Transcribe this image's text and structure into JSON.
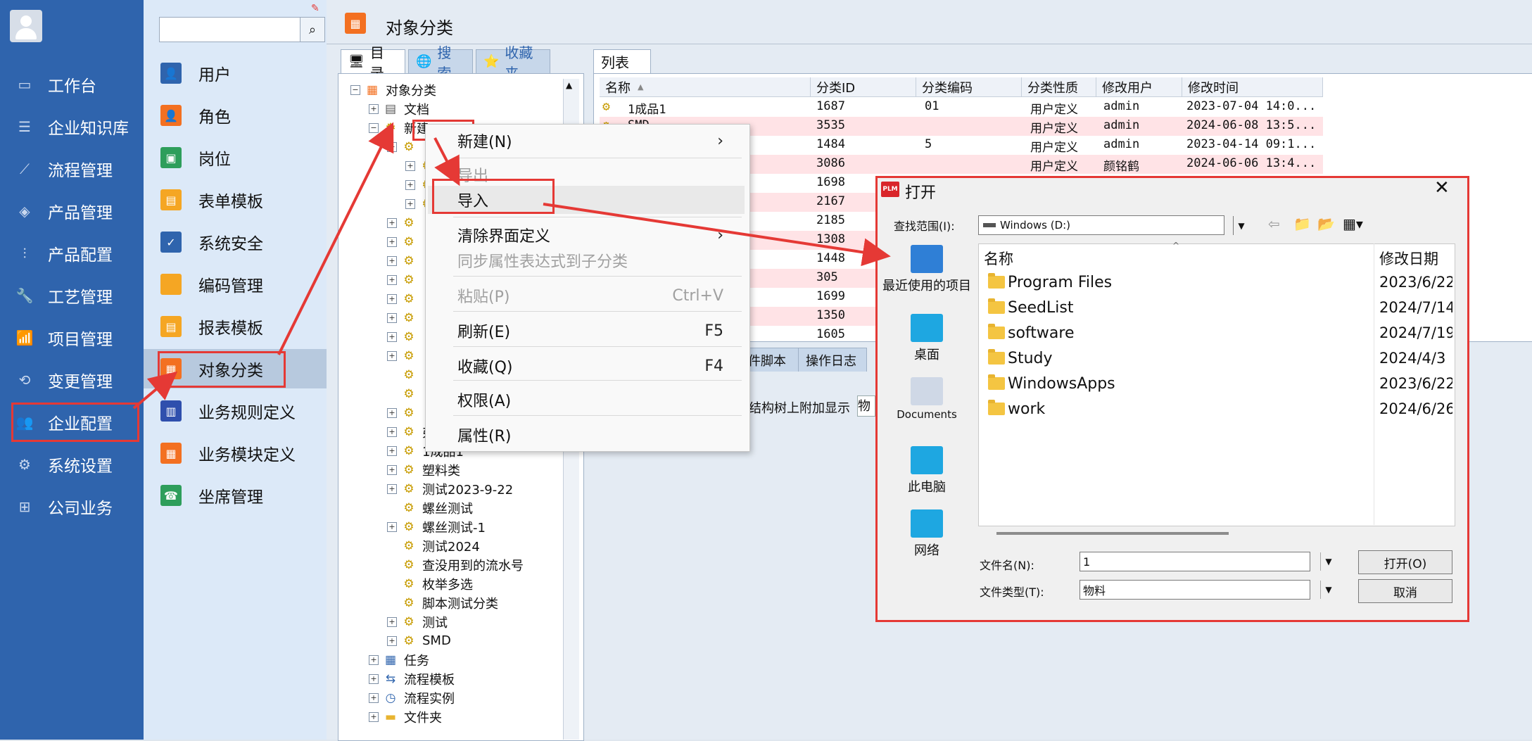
{
  "leftnav": {
    "items": [
      {
        "label": "工作台",
        "icon": "monitor-icon"
      },
      {
        "label": "企业知识库",
        "icon": "book-icon"
      },
      {
        "label": "流程管理",
        "icon": "flow-icon"
      },
      {
        "label": "产品管理",
        "icon": "cube-icon"
      },
      {
        "label": "产品配置",
        "icon": "sliders-icon"
      },
      {
        "label": "工艺管理",
        "icon": "wrench-icon"
      },
      {
        "label": "项目管理",
        "icon": "chart-icon"
      },
      {
        "label": "变更管理",
        "icon": "change-icon"
      },
      {
        "label": "企业配置",
        "icon": "users-icon"
      },
      {
        "label": "系统设置",
        "icon": "gear-icon"
      },
      {
        "label": "公司业务",
        "icon": "grid-icon"
      }
    ]
  },
  "subnav": {
    "items": [
      {
        "label": "用户",
        "color": "#2f64ad"
      },
      {
        "label": "角色",
        "color": "#f37021"
      },
      {
        "label": "岗位",
        "color": "#2e9e5b"
      },
      {
        "label": "表单模板",
        "color": "#f5a623"
      },
      {
        "label": "系统安全",
        "color": "#2f64ad"
      },
      {
        "label": "编码管理",
        "color": "#f5a623"
      },
      {
        "label": "报表模板",
        "color": "#f5a623"
      },
      {
        "label": "对象分类",
        "color": "#f37021"
      },
      {
        "label": "业务规则定义",
        "color": "#2f4fad"
      },
      {
        "label": "业务模块定义",
        "color": "#f37021"
      },
      {
        "label": "坐席管理",
        "color": "#2e9e5b"
      }
    ]
  },
  "main": {
    "title": "对象分类",
    "tabs": [
      "目录",
      "搜索",
      "收藏夹"
    ],
    "list_tab": "列表",
    "lower_tabs": [
      "件脚本",
      "操作日志"
    ],
    "lower_text": "结构树上附加显示",
    "lower_text2": "物"
  },
  "tree": {
    "rows": [
      {
        "label": "对象分类",
        "indent": 0,
        "pm": "−",
        "icon": "folder"
      },
      {
        "label": "文档",
        "indent": 1,
        "pm": "+",
        "icon": "doc"
      },
      {
        "label": "新建",
        "indent": 1,
        "pm": "−",
        "icon": "gear"
      },
      {
        "label": "",
        "indent": 2,
        "pm": "−",
        "icon": "gear"
      },
      {
        "label": "",
        "indent": 3,
        "pm": "+",
        "icon": "gear"
      },
      {
        "label": "",
        "indent": 3,
        "pm": "+",
        "icon": "gear"
      },
      {
        "label": "",
        "indent": 3,
        "pm": "+",
        "icon": "gear"
      },
      {
        "label": "",
        "indent": 2,
        "pm": "+",
        "icon": "gear"
      },
      {
        "label": "",
        "indent": 2,
        "pm": "+",
        "icon": "gear"
      },
      {
        "label": "",
        "indent": 2,
        "pm": "+",
        "icon": "gear"
      },
      {
        "label": "",
        "indent": 2,
        "pm": "+",
        "icon": "gear"
      },
      {
        "label": "",
        "indent": 2,
        "pm": "+",
        "icon": "gear"
      },
      {
        "label": "",
        "indent": 2,
        "pm": "+",
        "icon": "gear"
      },
      {
        "label": "",
        "indent": 2,
        "pm": "+",
        "icon": "gear"
      },
      {
        "label": "",
        "indent": 2,
        "pm": "+",
        "icon": "gear"
      },
      {
        "label": "",
        "indent": 2,
        "pm": "",
        "icon": "gear"
      },
      {
        "label": "",
        "indent": 2,
        "pm": "",
        "icon": "gear"
      },
      {
        "label": "",
        "indent": 2,
        "pm": "+",
        "icon": "gear"
      },
      {
        "label": "弗莱格",
        "indent": 2,
        "pm": "+",
        "icon": "gear"
      },
      {
        "label": "1成品1",
        "indent": 2,
        "pm": "+",
        "icon": "gear"
      },
      {
        "label": "塑料类",
        "indent": 2,
        "pm": "+",
        "icon": "gear"
      },
      {
        "label": "测试2023-9-22",
        "indent": 2,
        "pm": "+",
        "icon": "gear"
      },
      {
        "label": "螺丝测试",
        "indent": 2,
        "pm": "",
        "icon": "gear"
      },
      {
        "label": "螺丝测试-1",
        "indent": 2,
        "pm": "+",
        "icon": "gear"
      },
      {
        "label": "测试2024",
        "indent": 2,
        "pm": "",
        "icon": "gear"
      },
      {
        "label": "查没用到的流水号",
        "indent": 2,
        "pm": "",
        "icon": "gear"
      },
      {
        "label": "枚举多选",
        "indent": 2,
        "pm": "",
        "icon": "gear"
      },
      {
        "label": "脚本测试分类",
        "indent": 2,
        "pm": "",
        "icon": "gear"
      },
      {
        "label": "测试",
        "indent": 2,
        "pm": "+",
        "icon": "gear"
      },
      {
        "label": "SMD",
        "indent": 2,
        "pm": "+",
        "icon": "gear"
      },
      {
        "label": "任务",
        "indent": 1,
        "pm": "+",
        "icon": "calendar"
      },
      {
        "label": "流程模板",
        "indent": 1,
        "pm": "+",
        "icon": "flow"
      },
      {
        "label": "流程实例",
        "indent": 1,
        "pm": "+",
        "icon": "clock"
      },
      {
        "label": "文件夹",
        "indent": 1,
        "pm": "+",
        "icon": "folder2"
      }
    ]
  },
  "list": {
    "columns": [
      "名称",
      "分类ID",
      "分类编码",
      "分类性质",
      "修改用户",
      "修改时间"
    ],
    "rows": [
      {
        "name": "1成品1",
        "id": "1687",
        "code": "01",
        "kind": "用户定义",
        "user": "admin",
        "time": "2023-07-04 14:0...",
        "pink": false
      },
      {
        "name": "SMD",
        "id": "3535",
        "code": "",
        "kind": "用户定义",
        "user": "admin",
        "time": "2024-06-08 13:5...",
        "pink": true
      },
      {
        "name": "",
        "id": "1484",
        "code": "5",
        "kind": "用户定义",
        "user": "admin",
        "time": "2023-04-14 09:1...",
        "pink": false
      },
      {
        "name": "",
        "id": "3086",
        "code": "",
        "kind": "用户定义",
        "user": "颜铭鹤",
        "time": "2024-06-06 13:4...",
        "pink": true
      },
      {
        "name": "",
        "id": "1698",
        "code": "",
        "kind": "",
        "user": "",
        "time": "",
        "pink": false
      },
      {
        "name": "",
        "id": "2167",
        "code": "",
        "kind": "",
        "user": "",
        "time": "",
        "pink": true
      },
      {
        "name": "",
        "id": "2185",
        "code": "",
        "kind": "",
        "user": "",
        "time": "",
        "pink": false
      },
      {
        "name": "",
        "id": "1308",
        "code": "",
        "kind": "",
        "user": "",
        "time": "",
        "pink": true
      },
      {
        "name": "",
        "id": "1448",
        "code": "",
        "kind": "",
        "user": "",
        "time": "",
        "pink": false
      },
      {
        "name": "",
        "id": "305",
        "code": "",
        "kind": "",
        "user": "",
        "time": "",
        "pink": true
      },
      {
        "name": "",
        "id": "1699",
        "code": "",
        "kind": "",
        "user": "",
        "time": "",
        "pink": false
      },
      {
        "name": "",
        "id": "1350",
        "code": "",
        "kind": "",
        "user": "",
        "time": "",
        "pink": true
      },
      {
        "name": "",
        "id": "1605",
        "code": "",
        "kind": "",
        "user": "",
        "time": "",
        "pink": false
      }
    ]
  },
  "context_menu": {
    "items": [
      {
        "label": "新建(N)",
        "key": "›",
        "disabled": false
      },
      {
        "label": "导出",
        "key": "",
        "disabled": true
      },
      {
        "label": "导入",
        "key": "",
        "disabled": false
      },
      {
        "label": "清除界面定义",
        "key": "›",
        "disabled": false
      },
      {
        "label": "同步属性表达式到子分类",
        "key": "",
        "disabled": true
      },
      {
        "label": "粘贴(P)",
        "key": "Ctrl+V",
        "disabled": true
      },
      {
        "label": "刷新(E)",
        "key": "F5",
        "disabled": false
      },
      {
        "label": "收藏(Q)",
        "key": "F4",
        "disabled": false
      },
      {
        "label": "权限(A)",
        "key": "",
        "disabled": false
      },
      {
        "label": "属性(R)",
        "key": "",
        "disabled": false
      }
    ]
  },
  "dialog": {
    "logo_text": "PLM",
    "title": "打开",
    "close": "✕",
    "lookin_label": "查找范围(I):",
    "lookin_value": "Windows (D:)",
    "places": [
      "最近使用的项目",
      "桌面",
      "Documents",
      "此电脑",
      "网络"
    ],
    "col_name": "名称",
    "col_date": "修改日期",
    "files": [
      {
        "name": "Program Files",
        "date": "2023/6/22"
      },
      {
        "name": "SeedList",
        "date": "2024/7/14"
      },
      {
        "name": "software",
        "date": "2024/7/19"
      },
      {
        "name": "Study",
        "date": "2024/4/3"
      },
      {
        "name": "WindowsApps",
        "date": "2023/6/22"
      },
      {
        "name": "work",
        "date": "2024/6/26"
      }
    ],
    "filename_label": "文件名(N):",
    "filename_value": "1",
    "filetype_label": "文件类型(T):",
    "filetype_value": "物料",
    "open_btn": "打开(O)",
    "cancel_btn": "取消"
  },
  "colors": {
    "nav_bg": "#2f64ad",
    "highlight_red": "#e53935"
  }
}
